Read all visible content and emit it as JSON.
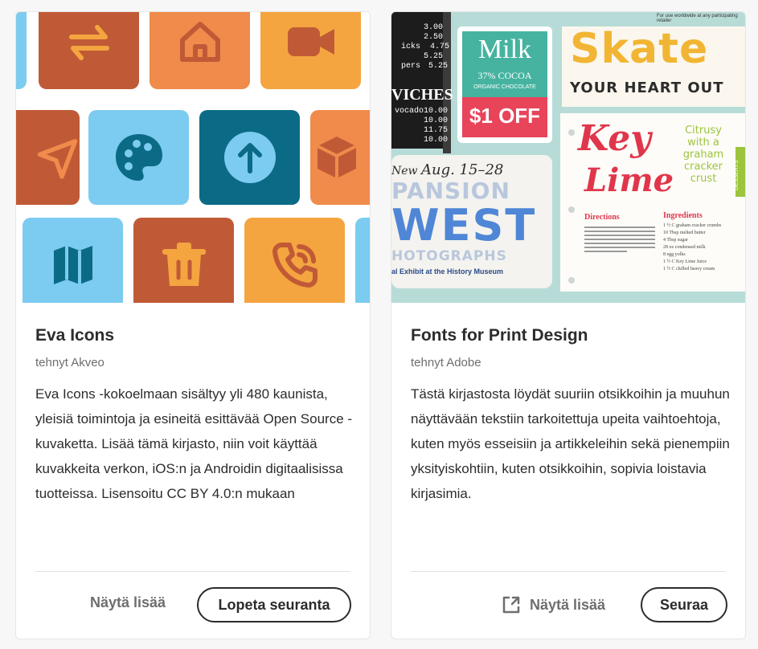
{
  "cards": [
    {
      "title": "Eva Icons",
      "author": "tehnyt Akveo",
      "description": "Eva Icons -kokoelmaan sisältyy yli 480 kaunista, yleisiä toimintoja ja esineitä esittävää Open Source -kuvaketta. Lisää tämä kirjasto, niin voit käyttää kuvakkeita verkon, iOS:n ja Androidin digitaalisissa tuotteissa. Lisensoitu CC BY 4.0:n mukaan",
      "show_more_label": "Näytä lisää",
      "follow_label": "Lopeta seuranta",
      "hero_icons": [
        "swap-icon",
        "home-icon",
        "video-icon",
        "navigation-icon",
        "palette-icon",
        "arrow-up-circle-icon",
        "cube-icon",
        "map-icon",
        "trash-icon",
        "phone-call-icon"
      ]
    },
    {
      "title": "Fonts for Print Design",
      "author": "tehnyt Adobe",
      "description": "Tästä kirjastosta löydät suuriin otsikkoihin ja muuhun näyttävään tekstiin tarkoitettuja upeita vaihtoehtoja, kuten myös esseisiin ja artikkeleihin sekä pienempiin yksityiskohtiin, kuten otsikkoihin, sopivia loistavia kirjasimia.",
      "show_more_label": "Näytä lisää",
      "follow_label": "Seuraa",
      "hero": {
        "menu_prices": [
          "3.00",
          "2.50",
          "4.75",
          "5.25",
          "5.25"
        ],
        "menu_items": [
          "icks",
          "pers"
        ],
        "sandwich_header": "VICHES",
        "sandwich_items": [
          "vocado",
          "10.00",
          "10.00",
          "11.75",
          "10.00"
        ],
        "milk_word": "Milk",
        "milk_sub": "37% COCOA",
        "milk_sub2": "ORGANIC CHOCOLATE",
        "milk_off": "$1 OFF",
        "skate_top": "For use worldwide at any participating retailer",
        "skate_word": "Skate",
        "skate_sub": "YOUR HEART OUT",
        "key_lime": "Key",
        "lime": "Lime",
        "citrusy": "Citrusy with a graham cracker crust",
        "desserts_tab": "DESSERTS",
        "directions": "Directions",
        "ingredients": "Ingredients",
        "ingredient_lines": [
          "1 ½ C graham cracker crumbs",
          "10 Tbsp melted butter",
          "4 Tbsp sugar",
          "28 oz condensed milk",
          "8 egg yolks",
          "1 ½ C Key Lime Juice",
          "1 ½ C chilled heavy cream"
        ],
        "aug_dates": "Aug. 15–28",
        "aug_prefix": "New",
        "expansion": "PANSION",
        "west": "WEST",
        "photographs": "HOTOGRAPHS",
        "exhibit": "al Exhibit at the History Museum"
      }
    }
  ],
  "colors": {
    "rust": "#c05a36",
    "orange": "#f08b4c",
    "amber": "#f4a540",
    "sky": "#7ccbf0",
    "teal": "#0b6b86",
    "ink": "#2c2c2c",
    "muted": "#6e6e6e"
  }
}
